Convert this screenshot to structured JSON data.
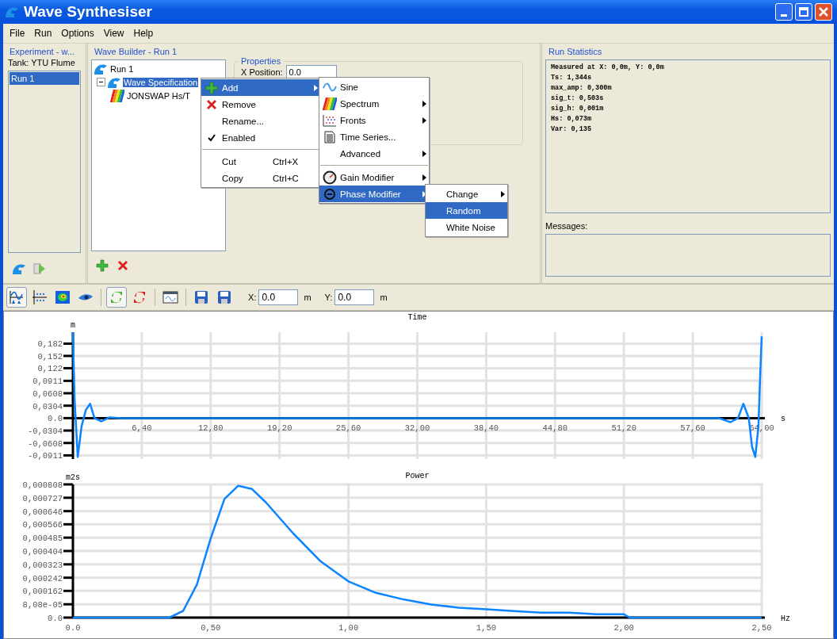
{
  "window": {
    "title": "Wave Synthesiser"
  },
  "menu_bar": [
    "File",
    "Run",
    "Options",
    "View",
    "Help"
  ],
  "experiment": {
    "title": "Experiment - w...",
    "tank": "Tank: YTU Flume",
    "runs": [
      {
        "label": "Run 1",
        "selected": true
      }
    ]
  },
  "wave_builder": {
    "title": "Wave Builder - Run 1",
    "tree": [
      {
        "label": "Run 1",
        "selected": false,
        "children": [
          {
            "label": "Wave Specification",
            "selected": true,
            "expanded": true,
            "children": [
              {
                "label": "JONSWAP Hs/T",
                "selected": false
              }
            ]
          }
        ]
      }
    ],
    "properties": {
      "title": "Properties",
      "x_position_label": "X Position:",
      "x_position_value": "0.0"
    }
  },
  "context_menus": [
    {
      "groups": [
        [
          {
            "label": "Add",
            "submenu": true,
            "selected": true,
            "checked": false
          },
          {
            "label": "Remove",
            "submenu": false,
            "selected": false,
            "checked": false
          },
          {
            "label": "Rename...",
            "submenu": false,
            "selected": false,
            "checked": false
          },
          {
            "label": "Enabled",
            "submenu": false,
            "selected": false,
            "checked": true
          }
        ],
        [
          {
            "label": "Cut",
            "shortcut": "Ctrl+X",
            "submenu": false,
            "selected": false,
            "checked": false
          },
          {
            "label": "Copy",
            "shortcut": "Ctrl+C",
            "submenu": false,
            "selected": false,
            "checked": false
          }
        ]
      ]
    },
    {
      "groups": [
        [
          {
            "label": "Sine",
            "submenu": false,
            "selected": false
          },
          {
            "label": "Spectrum",
            "submenu": true,
            "selected": false
          },
          {
            "label": "Fronts",
            "submenu": true,
            "selected": false
          },
          {
            "label": "Time Series...",
            "submenu": false,
            "selected": false
          },
          {
            "label": "Advanced",
            "submenu": true,
            "selected": false
          }
        ],
        [
          {
            "label": "Gain Modifier",
            "submenu": true,
            "selected": false
          },
          {
            "label": "Phase Modifier",
            "submenu": true,
            "selected": true
          }
        ]
      ]
    },
    {
      "groups": [
        [
          {
            "label": "Change",
            "submenu": true,
            "selected": false
          },
          {
            "label": "Random",
            "submenu": false,
            "selected": true
          },
          {
            "label": "White Noise",
            "submenu": false,
            "selected": false
          }
        ]
      ]
    }
  ],
  "run_statistics": {
    "title": "Run Statistics",
    "lines": [
      "Measured at X: 0,0m, Y: 0,0m",
      "Ts: 1,344s",
      "max_amp: 0,300m",
      "sig_t: 0,503s",
      "sig_h: 0,001m",
      "Hs: 0,073m",
      "Var: 0,135"
    ],
    "messages_label": "Messages:"
  },
  "toolbar": {
    "buttons": [
      {
        "selected": true
      },
      {
        "selected": false
      },
      {
        "selected": false
      },
      {
        "selected": false
      },
      {
        "selected": true
      },
      {
        "selected": false
      },
      {
        "selected": false
      },
      {
        "selected": false
      },
      {
        "selected": false
      }
    ],
    "x_label": "X:",
    "x_value": "0.0",
    "x_unit": "m",
    "y_label": "Y:",
    "y_value": "0.0",
    "y_unit": "m"
  },
  "charts": [
    {
      "chart_data": {
        "type": "line",
        "title": "Time",
        "xlabel": "s",
        "ylabel": "m",
        "grid": true,
        "xlim": [
          0,
          64
        ],
        "ylim": [
          -0.1,
          0.21
        ],
        "x": [
          0,
          0.15,
          0.45,
          0.8,
          1.2,
          1.6,
          2.0,
          2.65,
          3.4,
          4.5,
          6.4,
          12.8,
          19.2,
          25.6,
          32,
          38.4,
          44.8,
          51.2,
          57.6,
          60,
          61.1,
          61.8,
          62.3,
          62.8,
          63.1,
          63.4,
          63.7,
          63.85,
          64
        ],
        "series": [
          {
            "color": "#0a84ff",
            "values": [
              0.21,
              0.05,
              -0.095,
              -0.02,
              0.02,
              0.035,
              0,
              -0.008,
              0.002,
              0,
              0,
              0,
              0,
              0,
              0,
              0,
              0,
              0,
              0,
              0,
              -0.01,
              0,
              0.035,
              0,
              -0.07,
              -0.095,
              -0.02,
              0.1,
              0.2
            ]
          }
        ],
        "xticks": [
          {
            "value": 6.4,
            "label": "6,40"
          },
          {
            "value": 12.8,
            "label": "12,80"
          },
          {
            "value": 19.2,
            "label": "19,20"
          },
          {
            "value": 25.6,
            "label": "25,60"
          },
          {
            "value": 32,
            "label": "32,00"
          },
          {
            "value": 38.4,
            "label": "38,40"
          },
          {
            "value": 44.8,
            "label": "44,80"
          },
          {
            "value": 51.2,
            "label": "51,20"
          },
          {
            "value": 57.6,
            "label": "57,60"
          },
          {
            "value": 64,
            "label": "64,00"
          }
        ],
        "yticks": [
          {
            "value": 0.182,
            "label": "0,182"
          },
          {
            "value": 0.152,
            "label": "0,152"
          },
          {
            "value": 0.122,
            "label": "0,122"
          },
          {
            "value": 0.0911,
            "label": "0,0911"
          },
          {
            "value": 0.0608,
            "label": "0,0608"
          },
          {
            "value": 0.0304,
            "label": "0,0304"
          },
          {
            "value": 0,
            "label": "0.0"
          },
          {
            "value": -0.0304,
            "label": "-0,0304"
          },
          {
            "value": -0.0608,
            "label": "-0,0608"
          },
          {
            "value": -0.0911,
            "label": "-0,0911"
          }
        ]
      }
    },
    {
      "chart_data": {
        "type": "line",
        "title": "Power",
        "xlabel": "Hz",
        "ylabel": "m2s",
        "grid": true,
        "xlim": [
          0,
          2.5
        ],
        "ylim": [
          0,
          0.000808
        ],
        "x": [
          0,
          0.35,
          0.4,
          0.45,
          0.5,
          0.55,
          0.6,
          0.65,
          0.7,
          0.8,
          0.9,
          1.0,
          1.1,
          1.2,
          1.3,
          1.4,
          1.5,
          1.6,
          1.7,
          1.8,
          1.9,
          2.0,
          2.02,
          2.5
        ],
        "series": [
          {
            "color": "#0a84ff",
            "values": [
              0,
              0,
              4e-05,
              0.0002,
              0.00048,
              0.00072,
              0.0008,
              0.00078,
              0.0007,
              0.00051,
              0.00034,
              0.00022,
              0.00015,
              0.00011,
              8e-05,
              6e-05,
              5e-05,
              4e-05,
              3e-05,
              3e-05,
              2e-05,
              2e-05,
              0,
              0
            ]
          }
        ],
        "xticks": [
          {
            "value": 0,
            "label": "0.0"
          },
          {
            "value": 0.5,
            "label": "0,50"
          },
          {
            "value": 1,
            "label": "1,00"
          },
          {
            "value": 1.5,
            "label": "1,50"
          },
          {
            "value": 2,
            "label": "2,00"
          },
          {
            "value": 2.5,
            "label": "2,50"
          }
        ],
        "yticks": [
          {
            "value": 0,
            "label": "0.0"
          },
          {
            "value": 8.08e-05,
            "label": "8,08e-05"
          },
          {
            "value": 0.000162,
            "label": "0,000162"
          },
          {
            "value": 0.000242,
            "label": "0,000242"
          },
          {
            "value": 0.000323,
            "label": "0,000323"
          },
          {
            "value": 0.000404,
            "label": "0,000404"
          },
          {
            "value": 0.000485,
            "label": "0,000485"
          },
          {
            "value": 0.000566,
            "label": "0,000566"
          },
          {
            "value": 0.000646,
            "label": "0,000646"
          },
          {
            "value": 0.000727,
            "label": "0,000727"
          },
          {
            "value": 0.000808,
            "label": "0,000808"
          }
        ]
      }
    }
  ]
}
